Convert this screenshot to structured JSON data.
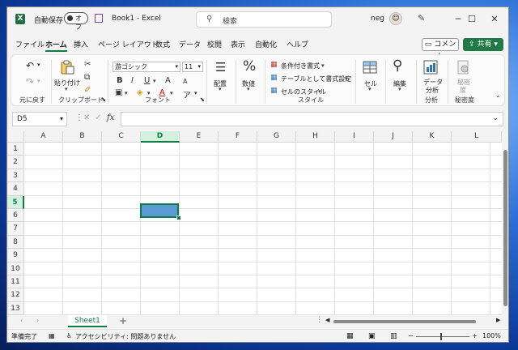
{
  "titlebar": {
    "app_logo": "X",
    "autosave_label": "自動保存",
    "autosave_state": "オフ",
    "document_title": "Book1  -  Excel",
    "search_placeholder": "検索",
    "user_name": "neg",
    "minimize": "─",
    "maximize": "☐",
    "close": "✕"
  },
  "tabs": [
    "ファイル",
    "ホーム",
    "挿入",
    "ページ レイアウト",
    "数式",
    "データ",
    "校閲",
    "表示",
    "自動化",
    "ヘルプ"
  ],
  "active_tab": "ホーム",
  "actions": {
    "comment": "コメント",
    "share": "共有"
  },
  "ribbon": {
    "undo_group": "元に戻す",
    "clipboard": {
      "label": "クリップボード",
      "paste": "貼り付け"
    },
    "font": {
      "label": "フォント",
      "font_name": "游ゴシック",
      "font_size": "11",
      "bold": "B",
      "italic": "I",
      "underline": "U",
      "grow": "A",
      "shrink": "A"
    },
    "alignment": {
      "label": "配置"
    },
    "number": {
      "label": "数値"
    },
    "styles": {
      "label": "スタイル",
      "conditional": "条件付き書式",
      "table": "テーブルとして書式設定",
      "cell_styles": "セルのスタイル"
    },
    "cells": {
      "label": "セル"
    },
    "editing": {
      "label": "編集"
    },
    "analysis": {
      "label": "分析",
      "data_analysis_1": "データ",
      "data_analysis_2": "分析"
    },
    "sensitivity": {
      "label": "秘密度",
      "btn_1": "秘密",
      "btn_2": "度"
    }
  },
  "formula_bar": {
    "name_box": "D5",
    "fx": "fx",
    "formula": ""
  },
  "grid": {
    "columns": [
      "A",
      "B",
      "C",
      "D",
      "E",
      "F",
      "G",
      "H",
      "I",
      "J",
      "K",
      "L"
    ],
    "rows": [
      "1",
      "2",
      "3",
      "4",
      "5",
      "6",
      "7",
      "8",
      "9",
      "10",
      "11",
      "12",
      "13"
    ],
    "selected_column": "D",
    "selected_row": "5"
  },
  "sheets": {
    "active": "Sheet1",
    "add": "+"
  },
  "statusbar": {
    "ready": "準備完了",
    "accessibility": "アクセシビリティ: 問題ありません",
    "zoom_minus": "−",
    "zoom_plus": "+",
    "zoom": "100%"
  }
}
